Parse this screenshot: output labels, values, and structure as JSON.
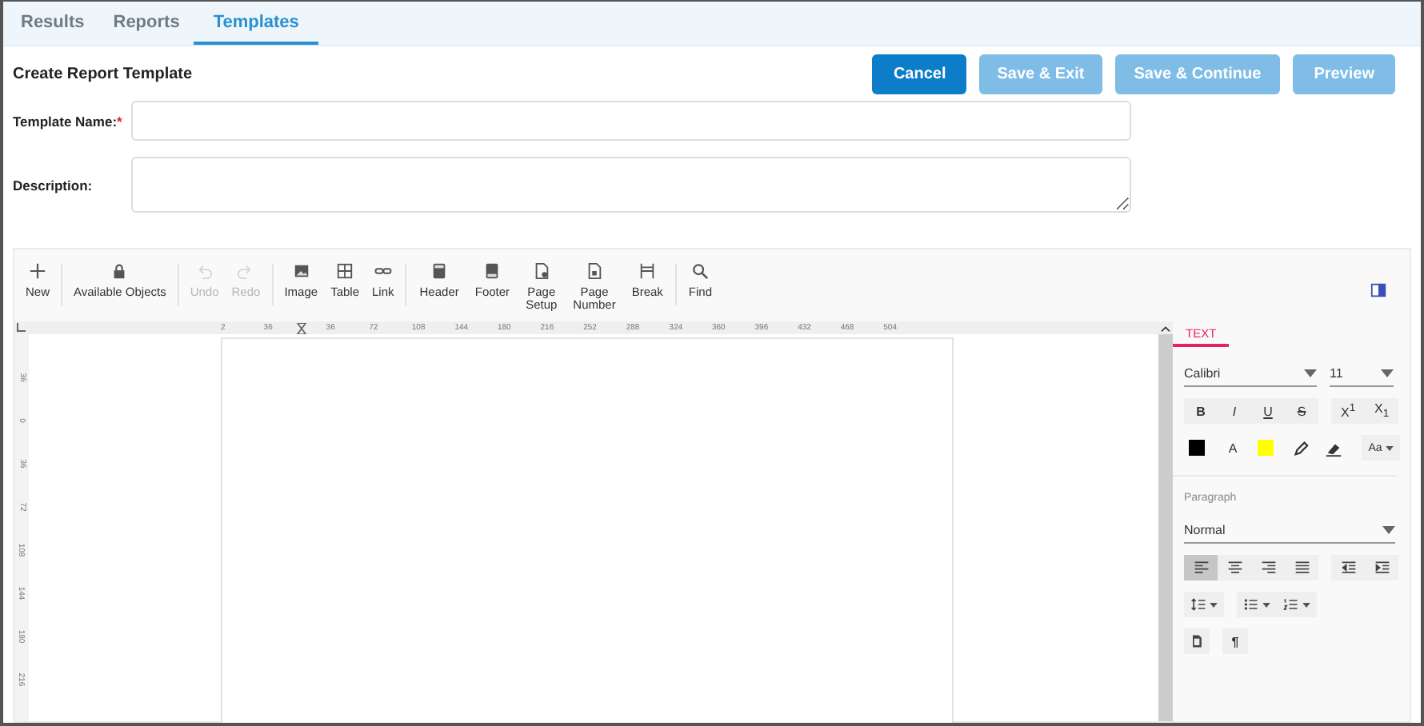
{
  "tabs": [
    {
      "label": "Results",
      "selected": false
    },
    {
      "label": "Reports",
      "selected": false
    },
    {
      "label": "Templates",
      "selected": true
    }
  ],
  "page_title": "Create Report Template",
  "actions": [
    {
      "label": "Cancel",
      "disabled": false
    },
    {
      "label": "Save & Exit",
      "disabled": true
    },
    {
      "label": "Save & Continue",
      "disabled": true
    },
    {
      "label": "Preview",
      "disabled": true
    }
  ],
  "fields": [
    {
      "label": "Template Name:",
      "required_mark": "*",
      "kind": "input"
    },
    {
      "label": "Description:",
      "kind": "textarea"
    }
  ],
  "toolbar": [
    [
      {
        "label": "New",
        "disabled": false
      }
    ],
    [
      {
        "label": "Available Objects",
        "disabled": false
      }
    ],
    [
      {
        "label": "Undo",
        "disabled": true
      },
      {
        "label": "Redo",
        "disabled": true
      }
    ],
    [
      {
        "label": "Image",
        "disabled": false
      },
      {
        "label": "Table",
        "disabled": false
      },
      {
        "label": "Link",
        "disabled": false
      }
    ],
    [
      {
        "label": "Header",
        "disabled": false
      },
      {
        "label": "Footer",
        "disabled": false
      },
      {
        "label": "Page Setup",
        "disabled": false
      },
      {
        "label": "Page Number",
        "disabled": false
      },
      {
        "label": "Break",
        "disabled": false
      }
    ],
    [
      {
        "label": "Find",
        "disabled": false
      }
    ]
  ],
  "ruler": {
    "horizontal": [
      "2",
      "36",
      "36",
      "72",
      "108",
      "144",
      "180",
      "216",
      "252",
      "288",
      "324",
      "360",
      "396",
      "432",
      "468",
      "504"
    ],
    "vertical": [
      "36",
      "0",
      "36",
      "72",
      "108",
      "144",
      "180",
      "216"
    ]
  },
  "side_panel": {
    "tab": {
      "label": "TEXT",
      "selected": true
    },
    "font": "Calibri",
    "size": "11",
    "format_groups": [
      [
        {
          "label": "B",
          "kind": "bold"
        },
        {
          "label": "I",
          "kind": "italic"
        },
        {
          "label": "U",
          "kind": "underline"
        },
        {
          "label": "S",
          "kind": "strike"
        }
      ],
      [
        {
          "label": "X$^{1}$",
          "kind": "plain"
        },
        {
          "label": "X$_{1}$",
          "kind": "plain"
        }
      ]
    ],
    "color_tools": [
      {
        "kind": "swatch",
        "color": "#000000"
      },
      {
        "kind": "text",
        "label": "A"
      },
      {
        "kind": "swatch",
        "color": "#ffff00"
      },
      {
        "kind": "highlighter"
      },
      {
        "kind": "eraser"
      },
      {
        "kind": "case",
        "label": "Aa"
      }
    ],
    "paragraph_label": "Paragraph",
    "style": "Normal",
    "align": [
      {
        "selected": true
      },
      {
        "selected": false
      },
      {
        "selected": false
      },
      {
        "selected": false
      }
    ],
    "extra": [
      {
        "label": "¶",
        "kind": "text"
      }
    ]
  }
}
